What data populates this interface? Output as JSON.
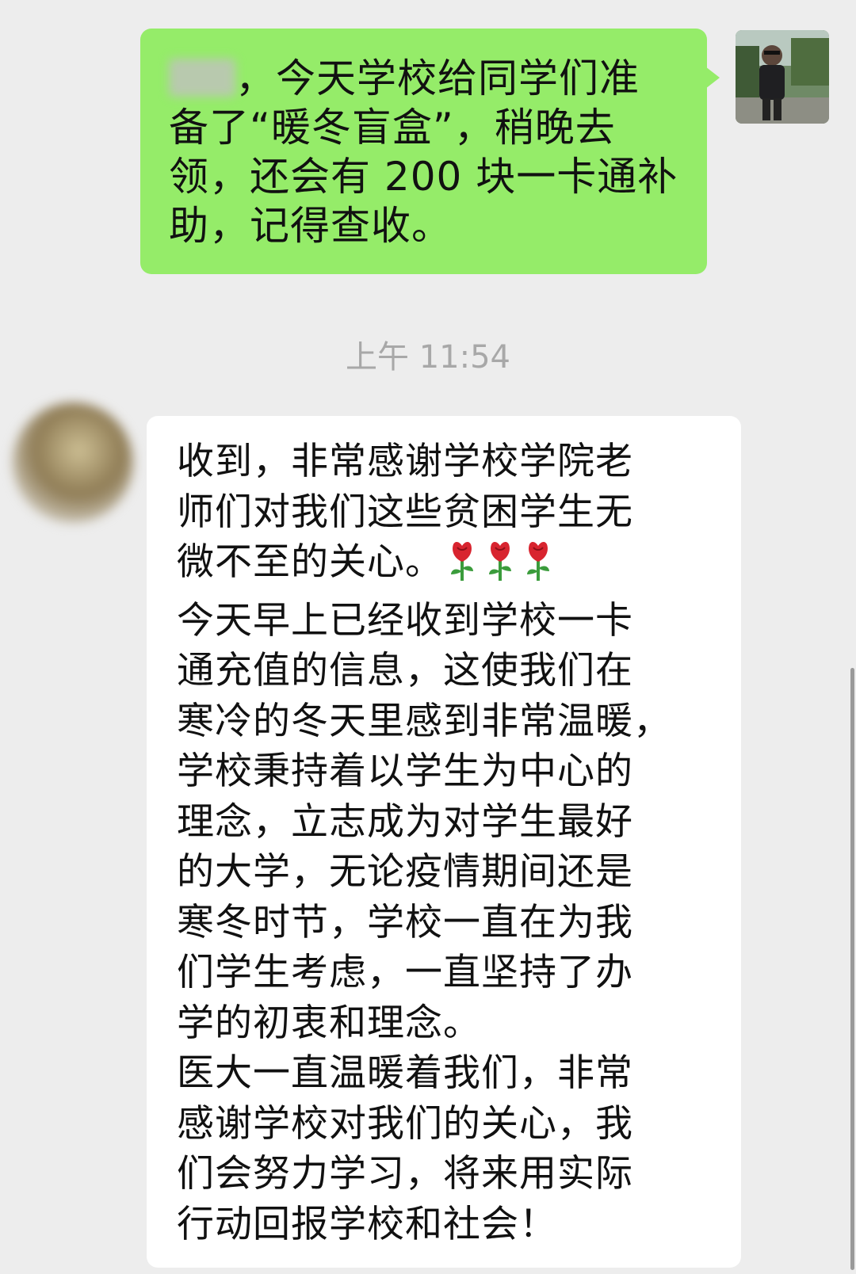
{
  "chat": {
    "outgoing_message": "，今天学校给同学们准\n备了“暖冬盲盒”，稍晚去\n领，还会有 200 块一卡通补\n助，记得查收。",
    "timestamp": "上午 11:54",
    "incoming_message_part1": "收到，非常感谢学校学院老\n师们对我们这些贫困学生无\n微不至的关心。",
    "incoming_message_part2": "今天早上已经收到学校一卡\n通充值的信息，这使我们在\n寒冷的冬天里感到非常温暖，\n学校秉持着以学生为中心的\n理念，立志成为对学生最好\n的大学，无论疫情期间还是\n寒冬时节，学校一直在为我\n们学生考虑，一直坚持了办\n学的初衷和理念。\n医大一直温暖着我们，非常\n感谢学校对我们的关心，我\n们会努力学习，将来用实际\n行动回报学校和社会！",
    "emoji": [
      "rose-icon",
      "rose-icon",
      "rose-icon"
    ]
  },
  "colors": {
    "background": "#ededed",
    "outgoing_bubble": "#95ec69",
    "incoming_bubble": "#ffffff",
    "timestamp_text": "#a8a8a8",
    "rose_petal": "#d8242f",
    "rose_stem": "#3b9c3c"
  }
}
